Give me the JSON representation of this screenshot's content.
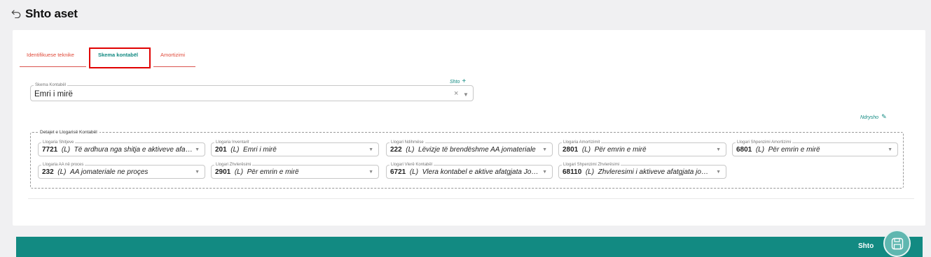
{
  "header": {
    "title": "Shto aset",
    "back_icon": "undo-arrow-icon"
  },
  "tabs": [
    {
      "label": "Identifikuese teknike",
      "active": false
    },
    {
      "label": "Skema kontabël",
      "active": true
    },
    {
      "label": "Amortizimi",
      "active": false
    }
  ],
  "schema": {
    "add_label": "Shto",
    "label": "Skema Kontabël",
    "value": "Emri i mirë"
  },
  "edit_label": "Ndrysho",
  "details": {
    "legend": "Detajet e Llogarisë Kontabël",
    "fields": [
      {
        "label": "Llogaria Shitjeve",
        "code": "7721",
        "type": "(L)",
        "name": "Të ardhura nga shitja e aktiveve afatgjata"
      },
      {
        "label": "Llogaria Inventarit",
        "code": "201",
        "type": "(L)",
        "name": "Emri i mirë"
      },
      {
        "label": "Llogari Ndihmëse",
        "code": "222",
        "type": "(L)",
        "name": "Lëvizje të brendëshme AA jomateriale"
      },
      {
        "label": "Llogaria Amortizimit",
        "code": "2801",
        "type": "(L)",
        "name": "Për emrin e mirë"
      },
      {
        "label": "Llogari Shpenzimi Amortizimi",
        "code": "6801",
        "type": "(L)",
        "name": "Për emrin e mirë"
      },
      {
        "label": "Llogaria AA në proces",
        "code": "232",
        "type": "(L)",
        "name": "AA jomateriale ne proçes"
      },
      {
        "label": "Llogari Zhvlerësimi",
        "code": "2901",
        "type": "(L)",
        "name": "Për emrin e mirë"
      },
      {
        "label": "Llogari Vlerë Kontabël",
        "code": "6721",
        "type": "(L)",
        "name": "Vlera kontabel e aktive afatgjata Jomateriale"
      },
      {
        "label": "Llogari Shpenzimi Zhvlerësimi",
        "code": "68110",
        "type": "(L)",
        "name": "Zhvleresimi i aktiveve afatgjata jomateriale"
      }
    ]
  },
  "footer": {
    "save_label": "Shto",
    "save_icon": "floppy-disk-icon"
  },
  "colors": {
    "accent": "#128a82",
    "tab_inactive": "#e04a3a",
    "highlight": "#e00000"
  }
}
